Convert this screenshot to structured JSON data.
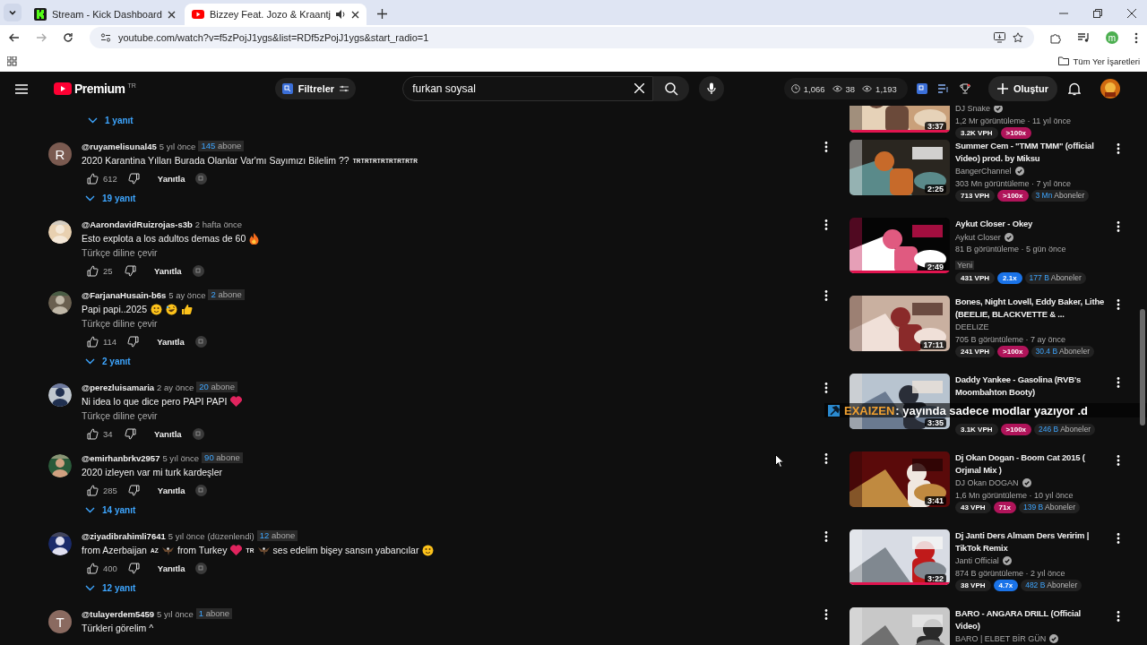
{
  "browser": {
    "tabs": [
      {
        "title": "Stream - Kick Dashboard",
        "selected": false,
        "audio": false
      },
      {
        "title": "Bizzey Feat. Jozo & Kraantj",
        "selected": true,
        "audio": true
      }
    ],
    "url": "youtube.com/watch?v=f5zPojJ1ygs&list=RDf5zPojJ1ygs&start_radio=1",
    "profile": "m",
    "bookmarks_folder": "Tüm Yer İşaretleri"
  },
  "header": {
    "logo": "Premium",
    "region": "TR",
    "filter": "Filtreler",
    "search": {
      "value": "furkan soysal"
    },
    "stats": [
      "1,066",
      "38",
      "1,193"
    ],
    "create": "Oluştur"
  },
  "comments": {
    "top_replies": "1 yanıt",
    "items": [
      {
        "handle": "@ruyamelisunal45",
        "time": "5 yıl önce",
        "subscribers": {
          "count": "145",
          "label": "abone"
        },
        "avatar": {
          "kind": "letter",
          "letter": "R",
          "color": "#7a5a50"
        },
        "parts": [
          {
            "kind": "text",
            "text": "2020 Karantina Yılları Burada Olanlar Var'mı Sayımızı Bilelim ??"
          },
          {
            "kind": "flag",
            "text": "TRTRTRTRTRTRTRTR"
          }
        ],
        "likes": "612",
        "reply": "Yanıtla",
        "replies": "19 yanıt"
      },
      {
        "handle": "@AarondavidRuizrojas-s3b",
        "time": "2 hafta önce",
        "avatar": {
          "kind": "picture"
        },
        "parts": [
          {
            "kind": "text",
            "text": "Esto explota a los adultos demas de 60"
          },
          {
            "kind": "fire"
          }
        ],
        "translate": "Türkçe diline çevir",
        "likes": "25",
        "reply": "Yanıtla"
      },
      {
        "handle": "@FarjanaHusain-b6s",
        "time": "5 ay önce",
        "subscribers": {
          "count": "2",
          "label": "abone"
        },
        "avatar": {
          "kind": "picture"
        },
        "parts": [
          {
            "kind": "text",
            "text": "Papi papi..2025"
          },
          {
            "kind": "smile"
          },
          {
            "kind": "laugh"
          },
          {
            "kind": "thumb"
          }
        ],
        "translate": "Türkçe diline çevir",
        "likes": "114",
        "reply": "Yanıtla",
        "replies": "2 yanıt"
      },
      {
        "handle": "@perezluisamaria",
        "time": "2 ay önce",
        "subscribers": {
          "count": "20",
          "label": "abone"
        },
        "avatar": {
          "kind": "picture"
        },
        "parts": [
          {
            "kind": "text",
            "text": "Ni idea lo que dice pero PAPI PAPI"
          },
          {
            "kind": "heart"
          }
        ],
        "translate": "Türkçe diline çevir",
        "likes": "34",
        "reply": "Yanıtla"
      },
      {
        "handle": "@emirhanbrkv2957",
        "time": "5 yıl önce",
        "subscribers": {
          "count": "90",
          "label": "abone"
        },
        "avatar": {
          "kind": "picture"
        },
        "parts": [
          {
            "kind": "text",
            "text": "2020 izleyen var mi turk kardeşler"
          }
        ],
        "likes": "285",
        "reply": "Yanıtla",
        "replies": "14 yanıt"
      },
      {
        "handle": "@ziyadibrahimli7641",
        "time": "5 yıl önce",
        "edited": "(düzenlendi)",
        "subscribers": {
          "count": "12",
          "label": "abone"
        },
        "avatar": {
          "kind": "picture"
        },
        "parts": [
          {
            "kind": "text",
            "text": "from Azerbaijan"
          },
          {
            "kind": "flag",
            "text": "AZ"
          },
          {
            "kind": "eagle"
          },
          {
            "kind": "text",
            "text": "from Turkey"
          },
          {
            "kind": "heart"
          },
          {
            "kind": "flag",
            "text": "TR"
          },
          {
            "kind": "eagle"
          },
          {
            "kind": "text",
            "text": "ses edelim bişey sansın yabancılar"
          },
          {
            "kind": "smile"
          }
        ],
        "likes": "400",
        "reply": "Yanıtla",
        "replies": "12 yanıt"
      },
      {
        "handle": "@tulayerdem5459",
        "time": "5 yıl önce",
        "subscribers": {
          "count": "1",
          "label": "abone"
        },
        "avatar": {
          "kind": "letter",
          "letter": "T",
          "color": "#8a6a60"
        },
        "parts": [
          {
            "kind": "text",
            "text": "Türkleri görelim ^"
          }
        ]
      }
    ]
  },
  "sidebar": [
    {
      "channel": "DJ Snake",
      "verified": true,
      "views": "1,2 Mr görüntüleme · 11 yıl önce",
      "vph": "3.2K VPH",
      "ratio": {
        "text": ">100x",
        "color": "#b0145a"
      },
      "duration": "3:37",
      "watched": true
    },
    {
      "title": "Summer Cem - \"TMM TMM\" (official Video) prod. by Miksu",
      "channel": "BangerChannel",
      "verified": true,
      "views": "303 Mn görüntüleme · 7 yıl önce",
      "vph": "713 VPH",
      "ratio": {
        "text": ">100x",
        "color": "#b0145a"
      },
      "subs": {
        "count": "3 Mn",
        "label": "Aboneler"
      },
      "duration": "2:25",
      "watched": false
    },
    {
      "title": "Aykut Closer - Okey",
      "channel": "Aykut Closer",
      "verified": true,
      "views": "81 B görüntüleme · 5 gün önce",
      "new_badge": "Yeni",
      "vph": "431 VPH",
      "ratio": {
        "text": "2.1x",
        "color": "#1a73e8"
      },
      "subs": {
        "count": "177 B",
        "label": "Aboneler"
      },
      "duration": "2:49",
      "watched": true
    },
    {
      "title": "Bones, Night Lovell, Eddy Baker, Lithe (BEELIE, BLACKVETTE & ...",
      "channel": "DEELIZE",
      "verified": false,
      "views": "705 B görüntüleme · 7 ay önce",
      "vph": "241 VPH",
      "ratio": {
        "text": ">100x",
        "color": "#b0145a"
      },
      "subs": {
        "count": "30.4 B",
        "label": "Aboneler"
      },
      "duration": "17:11",
      "watched": false
    },
    {
      "title": "Daddy Yankee - Gasolina (RVB's Moombahton Booty)",
      "vph": "3.1K VPH",
      "ratio": {
        "text": ">100x",
        "color": "#b0145a"
      },
      "subs": {
        "count": "246 B",
        "label": "Aboneler"
      },
      "duration": "3:35",
      "watched": false
    },
    {
      "title": "Dj Okan Dogan  - Boom Cat 2015 ( Orjınal Mix )",
      "channel": "DJ Okan DOGAN",
      "verified": true,
      "views": "1,6 Mn görüntüleme · 10 yıl önce",
      "vph": "43 VPH",
      "ratio": {
        "text": "71x",
        "color": "#b0145a"
      },
      "subs": {
        "count": "139 B",
        "label": "Aboneler"
      },
      "duration": "3:41",
      "watched": false
    },
    {
      "title": "Dj Janti Ders Almam Ders Veririm | TikTok Remix",
      "channel": "Janti Official",
      "verified": true,
      "views": "874 B görüntüleme · 2 yıl önce",
      "vph": "38 VPH",
      "ratio": {
        "text": "4.7x",
        "color": "#1a73e8"
      },
      "subs": {
        "count": "482 B",
        "label": "Aboneler"
      },
      "duration": "3:22",
      "watched": true
    },
    {
      "title": "BARO - ANGARA DRILL (Official Video)",
      "channel": "BARO | ELBET BİR GÜN",
      "verified": true,
      "watched": false
    }
  ],
  "chat_overlay": {
    "user": "EXAIZEN",
    "message": ": yayında sadece modlar yazıyor .d"
  }
}
